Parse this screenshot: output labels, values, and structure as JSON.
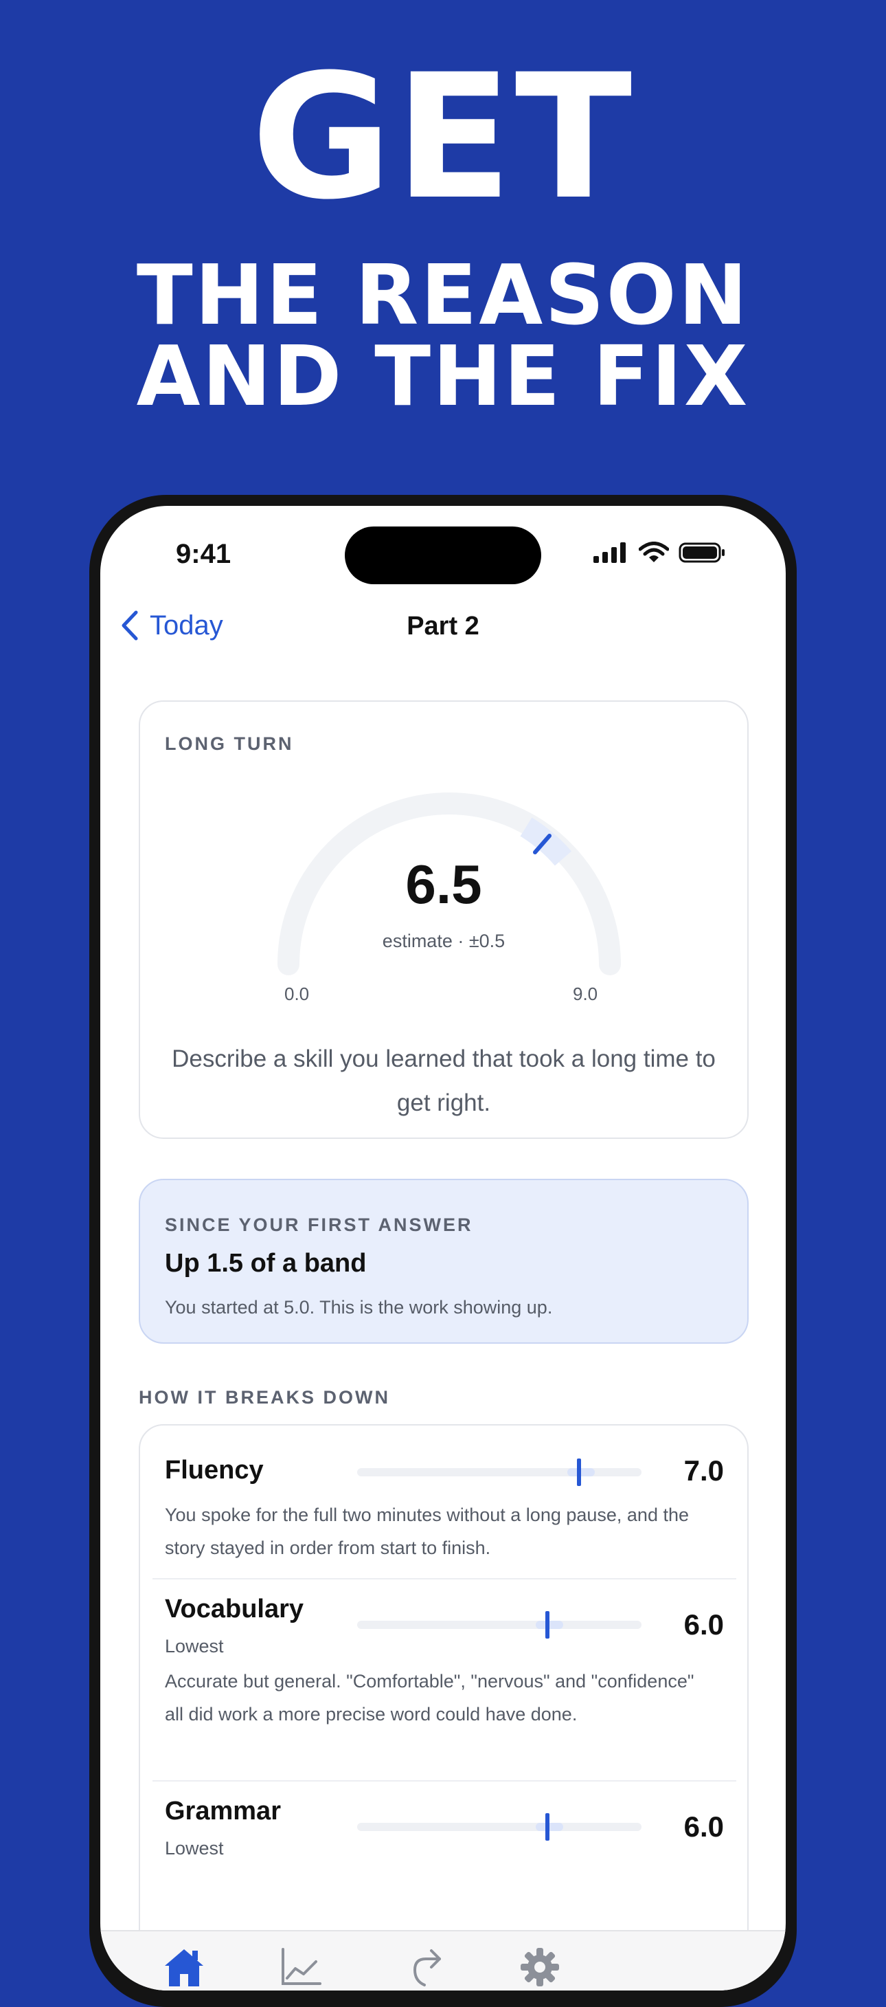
{
  "headline": {
    "line1": "GET",
    "line2": "THE REASON",
    "line3": "AND THE FIX"
  },
  "status_bar": {
    "time": "9:41"
  },
  "nav": {
    "back_label": "Today",
    "title": "Part 2"
  },
  "long_turn": {
    "eyebrow": "LONG TURN",
    "score": "6.5",
    "estimate": "estimate · ±0.5",
    "min_label": "0.0",
    "max_label": "9.0",
    "prompt": "Describe a skill you learned that took a long time to get right."
  },
  "progress": {
    "eyebrow": "SINCE YOUR FIRST ANSWER",
    "title": "Up 1.5 of a band",
    "body": "You started at 5.0. This is the work showing up."
  },
  "breakdown": {
    "label": "HOW IT BREAKS DOWN",
    "items": [
      {
        "name": "Fluency",
        "score": "7.0",
        "tag": "",
        "body": "You spoke for the full two minutes without a long pause, and the story stayed in order from start to finish."
      },
      {
        "name": "Vocabulary",
        "score": "6.0",
        "tag": "Lowest",
        "body": "Accurate but general. \"Comfortable\", \"nervous\" and \"confidence\" all did work a more precise word could have done."
      },
      {
        "name": "Grammar",
        "score": "6.0",
        "tag": "Lowest",
        "body": ""
      }
    ]
  },
  "colors": {
    "accent": "#2657d4",
    "background": "#1e3ba6"
  },
  "tabs": [
    "home-icon",
    "chart-icon",
    "share-icon",
    "gear-icon"
  ]
}
